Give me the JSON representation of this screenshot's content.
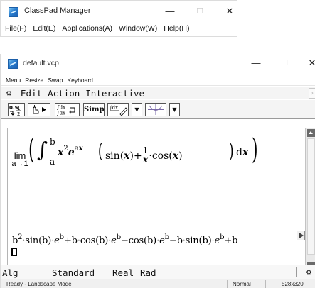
{
  "colors": {
    "window_border": "#dcdcdc",
    "toolbar_bg": "#f4f4f4",
    "scroll_btn": "#6a6a6a",
    "status_bg": "#f0f0f0"
  },
  "manager_window": {
    "title": "ClassPad Manager",
    "controls": {
      "minimize": "—",
      "maximize": "☐",
      "close": "✕"
    },
    "menu": [
      "File(F)",
      "Edit(E)",
      "Applications(A)",
      "Window(W)",
      "Help(H)"
    ]
  },
  "vcp_window": {
    "title": "default.vcp",
    "controls": {
      "minimize": "—",
      "maximize": "☐",
      "close": "✕"
    },
    "menu": [
      "Menu",
      "Resize",
      "Swap",
      "Keyboard"
    ],
    "calc_menu": [
      "Edit",
      "Action",
      "Interactive"
    ],
    "toolbar": [
      {
        "name": "fraction-decimal-button",
        "label": "0.5 ½"
      },
      {
        "name": "pointer-button",
        "label": "☝▶"
      },
      {
        "name": "integral-convert-button",
        "label": "∫dx ∫dx"
      },
      {
        "name": "simp-button",
        "label": "Simp"
      },
      {
        "name": "integral-button",
        "label": "∫dx"
      },
      {
        "name": "dropdown-1",
        "label": "▼"
      },
      {
        "name": "graph-button",
        "label": "⊹"
      },
      {
        "name": "dropdown-2",
        "label": "▼"
      }
    ],
    "work": {
      "input": {
        "lim_word": "lim",
        "lim_sub": "a→1",
        "upper": "b",
        "lower": "a",
        "x": "x",
        "two": "2",
        "e": "e",
        "ax": "a",
        "sin": "sin",
        "cos": "cos",
        "one": "1",
        "dx": "d"
      },
      "result": "b²·sin(b)·eᵇ+b·cos(b)·eᵇ−cos(b)·eᵇ−b·sin(b)·eᵇ+b"
    },
    "calc_status": [
      "Alg",
      "Standard",
      "Real",
      "Rad"
    ],
    "status_bar": {
      "left": "Ready - Landscape Mode",
      "mode": "Normal",
      "size": "528x320"
    }
  }
}
